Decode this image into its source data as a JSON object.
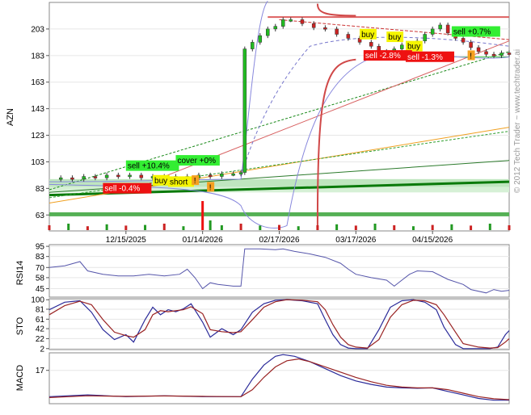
{
  "window": {
    "ticker": "AZN",
    "watermark": "© 2012 Tech Trader ~ www.techtrader.ai"
  },
  "chart_data": [
    {
      "type": "line",
      "name": "price",
      "ylabel": "AZN",
      "ylim": [
        51,
        223
      ],
      "ytick_labels": [
        "63",
        "83",
        "103",
        "123",
        "143",
        "163",
        "183",
        "203"
      ],
      "yticks": [
        63,
        83,
        103,
        123,
        143,
        163,
        183,
        203
      ],
      "xlim": [
        0,
        120
      ],
      "x_dates": [
        "12/15/2025",
        "01/14/2026",
        "02/17/2026",
        "03/17/2026",
        "04/15/2026"
      ],
      "x_date_index": [
        20,
        40,
        60,
        80,
        100
      ],
      "close": [
        [
          0,
          90
        ],
        [
          3,
          91
        ],
        [
          6,
          90
        ],
        [
          9,
          92
        ],
        [
          12,
          91
        ],
        [
          15,
          93
        ],
        [
          18,
          92
        ],
        [
          21,
          93
        ],
        [
          24,
          91
        ],
        [
          27,
          92
        ],
        [
          30,
          91
        ],
        [
          33,
          92
        ],
        [
          36,
          91
        ],
        [
          39,
          93
        ],
        [
          42,
          92
        ],
        [
          45,
          94
        ],
        [
          48,
          94
        ],
        [
          50,
          95
        ],
        [
          51,
          188
        ],
        [
          53,
          193
        ],
        [
          55,
          198
        ],
        [
          57,
          203
        ],
        [
          59,
          205
        ],
        [
          61,
          210
        ],
        [
          63,
          210
        ],
        [
          66,
          207
        ],
        [
          69,
          204
        ],
        [
          72,
          203
        ],
        [
          75,
          199
        ],
        [
          78,
          196
        ],
        [
          81,
          193
        ],
        [
          84,
          190
        ],
        [
          86,
          186
        ],
        [
          88,
          184
        ],
        [
          90,
          188
        ],
        [
          92,
          191
        ],
        [
          94,
          190
        ],
        [
          96,
          194
        ],
        [
          98,
          199
        ],
        [
          100,
          203
        ],
        [
          102,
          206
        ],
        [
          104,
          200
        ],
        [
          106,
          196
        ],
        [
          108,
          193
        ],
        [
          110,
          189
        ],
        [
          112,
          186
        ],
        [
          114,
          184
        ],
        [
          116,
          183
        ],
        [
          118,
          185
        ],
        [
          120,
          184
        ]
      ],
      "volume": [
        [
          0,
          0.15
        ],
        [
          5,
          0.2
        ],
        [
          10,
          0.12
        ],
        [
          15,
          0.18
        ],
        [
          20,
          0.14
        ],
        [
          25,
          0.16
        ],
        [
          30,
          0.2
        ],
        [
          35,
          0.12
        ],
        [
          40,
          0.9
        ],
        [
          42,
          0.3
        ],
        [
          45,
          0.15
        ],
        [
          50,
          0.2
        ],
        [
          55,
          0.14
        ],
        [
          60,
          0.16
        ],
        [
          65,
          0.12
        ],
        [
          70,
          0.15
        ],
        [
          75,
          0.18
        ],
        [
          80,
          0.14
        ],
        [
          85,
          0.2
        ],
        [
          90,
          0.15
        ],
        [
          95,
          0.12
        ],
        [
          100,
          0.16
        ],
        [
          105,
          0.18
        ],
        [
          110,
          0.14
        ],
        [
          115,
          0.2
        ],
        [
          120,
          0.15
        ]
      ],
      "signals": [
        {
          "label": "sell +10.4%",
          "x": 20,
          "y": 98,
          "color": "#33ee33"
        },
        {
          "label": "cover +0%",
          "x": 33,
          "y": 102,
          "color": "#33ee33"
        },
        {
          "label": "sell -0.4%",
          "x": 14,
          "y": 81,
          "color": "#ee1111"
        },
        {
          "label": "buy",
          "x": 27,
          "y": 87,
          "color": "#f5f500"
        },
        {
          "label": "short",
          "x": 31,
          "y": 86,
          "color": "#f5f500"
        },
        {
          "label": "buy",
          "x": 81,
          "y": 197,
          "color": "#f5f500"
        },
        {
          "label": "buy",
          "x": 88,
          "y": 195,
          "color": "#f5f500"
        },
        {
          "label": "buy",
          "x": 93,
          "y": 188,
          "color": "#f5f500"
        },
        {
          "label": "sell +0.7%",
          "x": 105,
          "y": 199,
          "color": "#33ee33"
        },
        {
          "label": "sell -2.8%",
          "x": 82,
          "y": 181,
          "color": "#ee1111"
        },
        {
          "label": "sell -1.3%",
          "x": 93,
          "y": 180,
          "color": "#ee1111"
        }
      ],
      "alerts": [
        {
          "label": "!",
          "x": 38,
          "y": 88
        },
        {
          "label": "!",
          "x": 42,
          "y": 83
        },
        {
          "label": "!",
          "x": 110,
          "y": 182
        }
      ]
    },
    {
      "type": "line",
      "name": "RSI14",
      "ylabel": "RSI14",
      "ylim": [
        35,
        97
      ],
      "ytick_labels": [
        "45",
        "58",
        "70",
        "83",
        "95"
      ],
      "yticks": [
        45,
        58,
        70,
        83,
        95
      ],
      "values": [
        [
          0,
          70
        ],
        [
          4,
          72
        ],
        [
          8,
          77
        ],
        [
          10,
          66
        ],
        [
          14,
          62
        ],
        [
          18,
          60
        ],
        [
          22,
          60
        ],
        [
          26,
          62
        ],
        [
          30,
          60
        ],
        [
          34,
          62
        ],
        [
          36,
          68
        ],
        [
          38,
          58
        ],
        [
          40,
          45
        ],
        [
          42,
          52
        ],
        [
          44,
          50
        ],
        [
          48,
          48
        ],
        [
          50,
          48
        ],
        [
          51,
          92
        ],
        [
          55,
          92
        ],
        [
          59,
          91
        ],
        [
          61,
          92
        ],
        [
          64,
          89
        ],
        [
          68,
          86
        ],
        [
          72,
          82
        ],
        [
          76,
          75
        ],
        [
          78,
          68
        ],
        [
          80,
          62
        ],
        [
          84,
          58
        ],
        [
          88,
          55
        ],
        [
          90,
          48
        ],
        [
          92,
          55
        ],
        [
          94,
          62
        ],
        [
          96,
          66
        ],
        [
          100,
          65
        ],
        [
          104,
          56
        ],
        [
          108,
          50
        ],
        [
          110,
          44
        ],
        [
          114,
          40
        ],
        [
          116,
          44
        ],
        [
          118,
          42
        ],
        [
          120,
          43
        ]
      ]
    },
    {
      "type": "line",
      "name": "STO",
      "ylabel": "STO",
      "ylim": [
        0,
        102
      ],
      "ytick_labels": [
        "2",
        "22",
        "42",
        "61",
        "81",
        "100"
      ],
      "yticks": [
        2,
        22,
        42,
        61,
        81,
        100
      ],
      "series": [
        {
          "values": [
            [
              0,
              80
            ],
            [
              4,
              95
            ],
            [
              8,
              98
            ],
            [
              11,
              75
            ],
            [
              14,
              40
            ],
            [
              17,
              20
            ],
            [
              20,
              30
            ],
            [
              22,
              15
            ],
            [
              25,
              60
            ],
            [
              27,
              85
            ],
            [
              29,
              70
            ],
            [
              31,
              80
            ],
            [
              33,
              76
            ],
            [
              35,
              82
            ],
            [
              37,
              92
            ],
            [
              40,
              55
            ],
            [
              42,
              25
            ],
            [
              45,
              42
            ],
            [
              48,
              30
            ],
            [
              50,
              40
            ],
            [
              53,
              75
            ],
            [
              56,
              92
            ],
            [
              59,
              99
            ],
            [
              62,
              100
            ],
            [
              66,
              98
            ],
            [
              70,
              92
            ],
            [
              72,
              60
            ],
            [
              74,
              30
            ],
            [
              76,
              10
            ],
            [
              78,
              3
            ],
            [
              80,
              2
            ],
            [
              83,
              2
            ],
            [
              86,
              40
            ],
            [
              89,
              85
            ],
            [
              92,
              98
            ],
            [
              95,
              100
            ],
            [
              98,
              95
            ],
            [
              101,
              80
            ],
            [
              103,
              45
            ],
            [
              106,
              10
            ],
            [
              108,
              2
            ],
            [
              112,
              2
            ],
            [
              115,
              2
            ],
            [
              117,
              5
            ],
            [
              119,
              30
            ],
            [
              120,
              38
            ]
          ]
        },
        {
          "values": [
            [
              0,
              70
            ],
            [
              4,
              88
            ],
            [
              8,
              97
            ],
            [
              11,
              90
            ],
            [
              14,
              60
            ],
            [
              17,
              35
            ],
            [
              20,
              28
            ],
            [
              22,
              25
            ],
            [
              25,
              40
            ],
            [
              27,
              70
            ],
            [
              29,
              78
            ],
            [
              31,
              76
            ],
            [
              33,
              78
            ],
            [
              35,
              80
            ],
            [
              37,
              86
            ],
            [
              40,
              72
            ],
            [
              42,
              40
            ],
            [
              45,
              36
            ],
            [
              48,
              34
            ],
            [
              50,
              36
            ],
            [
              53,
              60
            ],
            [
              56,
              85
            ],
            [
              59,
              96
            ],
            [
              62,
              100
            ],
            [
              66,
              99
            ],
            [
              70,
              96
            ],
            [
              72,
              80
            ],
            [
              74,
              50
            ],
            [
              76,
              25
            ],
            [
              78,
              10
            ],
            [
              80,
              5
            ],
            [
              83,
              3
            ],
            [
              86,
              20
            ],
            [
              89,
              65
            ],
            [
              92,
              90
            ],
            [
              95,
              99
            ],
            [
              98,
              98
            ],
            [
              101,
              90
            ],
            [
              103,
              70
            ],
            [
              106,
              35
            ],
            [
              108,
              12
            ],
            [
              112,
              5
            ],
            [
              115,
              3
            ],
            [
              117,
              4
            ],
            [
              119,
              15
            ],
            [
              120,
              22
            ]
          ]
        }
      ]
    },
    {
      "type": "line",
      "name": "MACD",
      "ylabel": "MACD",
      "ylim": [
        -2,
        27
      ],
      "ytick_labels": [
        "17"
      ],
      "yticks": [
        17
      ],
      "series": [
        {
          "values": [
            [
              0,
              2
            ],
            [
              10,
              3
            ],
            [
              20,
              2
            ],
            [
              30,
              2.5
            ],
            [
              40,
              2
            ],
            [
              50,
              2
            ],
            [
              53,
              12
            ],
            [
              56,
              20
            ],
            [
              59,
              25
            ],
            [
              61,
              26
            ],
            [
              64,
              25
            ],
            [
              68,
              22
            ],
            [
              72,
              18
            ],
            [
              76,
              14
            ],
            [
              80,
              11
            ],
            [
              84,
              9
            ],
            [
              88,
              7.5
            ],
            [
              92,
              7
            ],
            [
              96,
              6.8
            ],
            [
              100,
              7
            ],
            [
              104,
              5
            ],
            [
              108,
              3
            ],
            [
              112,
              1
            ],
            [
              116,
              0
            ],
            [
              120,
              0
            ]
          ]
        },
        {
          "values": [
            [
              0,
              1.5
            ],
            [
              10,
              2.5
            ],
            [
              20,
              2.2
            ],
            [
              30,
              2.4
            ],
            [
              40,
              2.2
            ],
            [
              50,
              2
            ],
            [
              53,
              6
            ],
            [
              56,
              13
            ],
            [
              59,
              19
            ],
            [
              62,
              22.5
            ],
            [
              65,
              23.5
            ],
            [
              68,
              22
            ],
            [
              72,
              19
            ],
            [
              76,
              16
            ],
            [
              80,
              13
            ],
            [
              84,
              10.5
            ],
            [
              88,
              8.5
            ],
            [
              92,
              7.5
            ],
            [
              96,
              7
            ],
            [
              100,
              7
            ],
            [
              104,
              6
            ],
            [
              108,
              4
            ],
            [
              112,
              2
            ],
            [
              116,
              0.8
            ],
            [
              120,
              0.3
            ]
          ]
        }
      ]
    }
  ]
}
